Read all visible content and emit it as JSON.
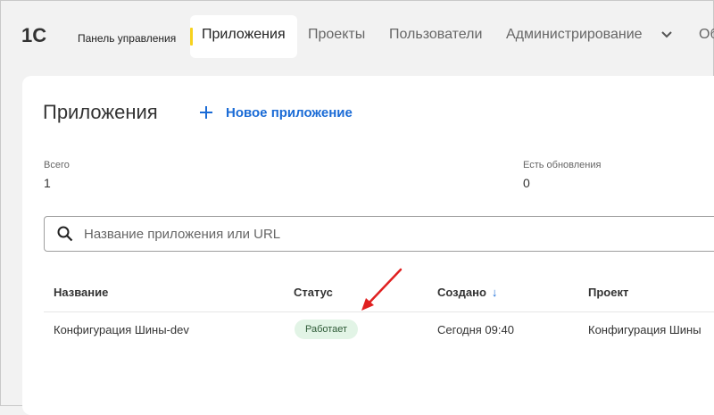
{
  "header": {
    "logo": "1С",
    "panel_title": "Панель управления",
    "nav": [
      {
        "label": "Приложения",
        "active": true
      },
      {
        "label": "Проекты"
      },
      {
        "label": "Пользователи"
      },
      {
        "label": "Администрирование"
      },
      {
        "label": "Об"
      }
    ]
  },
  "page": {
    "title": "Приложения",
    "new_app_label": "Новое приложение",
    "stats": [
      {
        "label": "Всего",
        "value": "1"
      },
      {
        "label": "Есть обновления",
        "value": "0"
      }
    ],
    "search": {
      "placeholder": "Название приложения или URL",
      "value": ""
    }
  },
  "table": {
    "columns": [
      "Название",
      "Статус",
      "Создано",
      "Проект"
    ],
    "rows": [
      {
        "name": "Конфигурация Шины-dev",
        "status": "Работает",
        "created": "Сегодня 09:40",
        "project": "Конфигурация Шины"
      }
    ]
  },
  "colors": {
    "accent": "#1a6bd6",
    "active_marker": "#f7d21e",
    "status_ok_bg": "#e2f4e6",
    "annotation_arrow": "#e02020"
  }
}
